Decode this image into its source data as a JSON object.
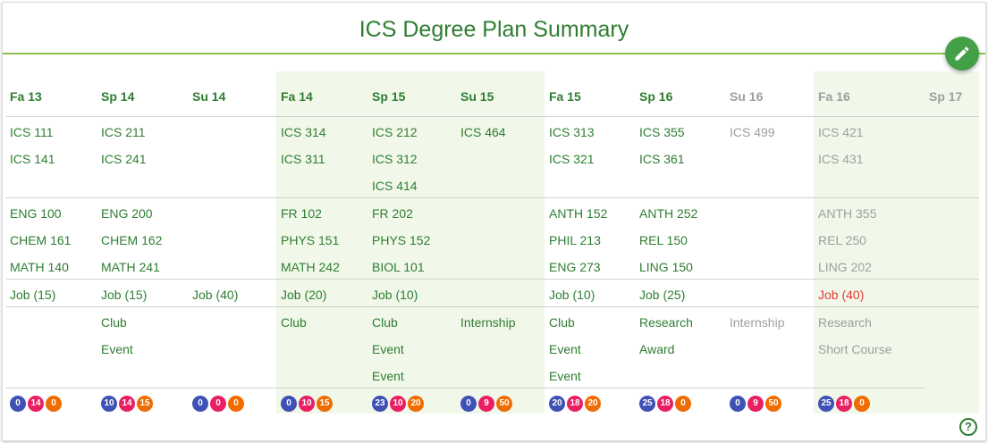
{
  "title": "ICS Degree Plan Summary",
  "icons": {
    "edit": "pencil-icon",
    "help": "help-circle-icon"
  },
  "colors": {
    "text": "#2e7d32",
    "future": "#9e9e9e",
    "warning": "#e53935",
    "shade": "#f1f8e9",
    "fab": "#43a047"
  },
  "semesters": [
    {
      "label": "Fa 13",
      "status": "past",
      "ics": [
        "ICS 111",
        "ICS 141"
      ],
      "other": [
        "ENG 100",
        "CHEM 161",
        "MATH 140"
      ],
      "job": "Job (15)",
      "activities": [],
      "levels": [
        "0",
        "14",
        "0"
      ]
    },
    {
      "label": "Sp 14",
      "status": "past",
      "ics": [
        "ICS 211",
        "ICS 241"
      ],
      "other": [
        "ENG 200",
        "CHEM 162",
        "MATH 241"
      ],
      "job": "Job (15)",
      "activities": [
        "Club",
        "Event"
      ],
      "levels": [
        "10",
        "14",
        "15"
      ]
    },
    {
      "label": "Su 14",
      "status": "past",
      "ics": [],
      "other": [],
      "job": "Job (40)",
      "activities": [],
      "levels": [
        "0",
        "0",
        "0"
      ]
    },
    {
      "label": "Fa 14",
      "status": "past",
      "ics": [
        "ICS 314",
        "ICS 311"
      ],
      "other": [
        "FR 102",
        "PHYS 151",
        "MATH 242"
      ],
      "job": "Job (20)",
      "activities": [
        "Club"
      ],
      "levels": [
        "0",
        "10",
        "15"
      ]
    },
    {
      "label": "Sp 15",
      "status": "past",
      "ics": [
        "ICS 212",
        "ICS 312",
        "ICS 414"
      ],
      "other": [
        "FR 202",
        "PHYS 152",
        "BIOL 101"
      ],
      "job": "Job (10)",
      "activities": [
        "Club",
        "Event",
        "Event"
      ],
      "levels": [
        "23",
        "10",
        "20"
      ]
    },
    {
      "label": "Su 15",
      "status": "past",
      "ics": [
        "ICS 464"
      ],
      "other": [],
      "job": "",
      "activities": [
        "Internship"
      ],
      "levels": [
        "0",
        "9",
        "50"
      ]
    },
    {
      "label": "Fa 15",
      "status": "past",
      "ics": [
        "ICS 313",
        "ICS 321"
      ],
      "other": [
        "ANTH 152",
        "PHIL 213",
        "ENG 273"
      ],
      "job": "Job (10)",
      "activities": [
        "Club",
        "Event",
        "Event"
      ],
      "levels": [
        "20",
        "18",
        "20"
      ]
    },
    {
      "label": "Sp 16",
      "status": "past",
      "ics": [
        "ICS 355",
        "ICS 361"
      ],
      "other": [
        "ANTH 252",
        "REL 150",
        "LING 150"
      ],
      "job": "Job (25)",
      "activities": [
        "Research",
        "Award"
      ],
      "levels": [
        "25",
        "18",
        "0"
      ]
    },
    {
      "label": "Su 16",
      "status": "future",
      "ics": [
        "ICS 499"
      ],
      "other": [],
      "job": "",
      "activities": [
        "Internship"
      ],
      "levels": [
        "0",
        "9",
        "50"
      ]
    },
    {
      "label": "Fa 16",
      "status": "future",
      "ics": [
        "ICS 421",
        "ICS 431"
      ],
      "other": [
        "ANTH 355",
        "REL 250",
        "LING 202"
      ],
      "job": "Job (40)",
      "job_warning": true,
      "activities": [
        "Research",
        "Short Course"
      ],
      "levels": [
        "25",
        "18",
        "0"
      ]
    },
    {
      "label": "Sp 17",
      "status": "future",
      "ics": [],
      "other": [],
      "job": "",
      "activities": [],
      "levels": []
    }
  ],
  "help_label": "?"
}
